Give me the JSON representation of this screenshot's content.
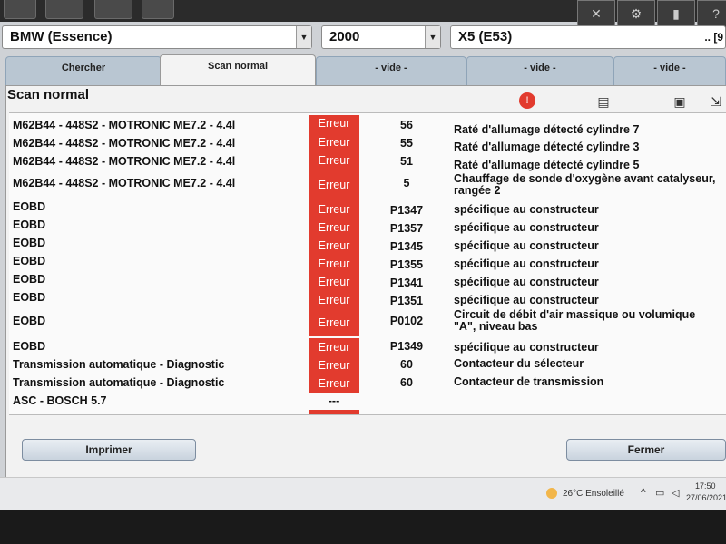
{
  "header": {
    "make": "BMW (Essence)",
    "year": "2000",
    "model": "X5 (E53)",
    "model_extra": ".. [9"
  },
  "toolbar_right": {
    "icons": [
      "tools-icon",
      "settings-icon",
      "book-icon",
      "help-icon"
    ],
    "help_label": "?"
  },
  "tabs": [
    {
      "label": "Chercher",
      "active": false
    },
    {
      "label": "Scan normal",
      "active": true
    },
    {
      "label": "- vide -",
      "active": false
    },
    {
      "label": "- vide -",
      "active": false
    },
    {
      "label": "- vide -",
      "active": false
    }
  ],
  "panel": {
    "title": "Scan normal",
    "stop_label": "!"
  },
  "rows": [
    {
      "system": "M62B44 - 448S2 - MOTRONIC ME7.2 - 4.4l",
      "status": "Erreur",
      "code": "56",
      "desc": "Raté d'allumage détecté cylindre 7"
    },
    {
      "system": "M62B44 - 448S2 - MOTRONIC ME7.2 - 4.4l",
      "status": "Erreur",
      "code": "55",
      "desc": "Raté d'allumage détecté cylindre 3"
    },
    {
      "system": "M62B44 - 448S2 - MOTRONIC ME7.2 - 4.4l",
      "status": "Erreur",
      "code": "51",
      "desc": "Raté d'allumage détecté cylindre 5"
    },
    {
      "system": "M62B44 - 448S2 - MOTRONIC ME7.2 - 4.4l",
      "status": "Erreur",
      "code": "5",
      "desc": "Chauffage de sonde d'oxygène avant catalyseur, rangée 2"
    },
    {
      "system": "EOBD",
      "status": "Erreur",
      "code": "P1347",
      "desc": "spécifique au constructeur"
    },
    {
      "system": "EOBD",
      "status": "Erreur",
      "code": "P1357",
      "desc": "spécifique au constructeur"
    },
    {
      "system": "EOBD",
      "status": "Erreur",
      "code": "P1345",
      "desc": "spécifique au constructeur"
    },
    {
      "system": "EOBD",
      "status": "Erreur",
      "code": "P1355",
      "desc": "spécifique au constructeur"
    },
    {
      "system": "EOBD",
      "status": "Erreur",
      "code": "P1341",
      "desc": "spécifique au constructeur"
    },
    {
      "system": "EOBD",
      "status": "Erreur",
      "code": "P1351",
      "desc": "spécifique au constructeur"
    },
    {
      "system": "EOBD",
      "status": "Erreur",
      "code": "P0102",
      "desc": "Circuit de débit d'air massique ou volumique \"A\", niveau bas"
    },
    {
      "system": "EOBD",
      "status": "Erreur",
      "code": "P1349",
      "desc": "spécifique au constructeur"
    },
    {
      "system": "Transmission automatique - Diagnostic",
      "status": "Erreur",
      "code": "60",
      "desc": "Contacteur du sélecteur"
    },
    {
      "system": "Transmission automatique - Diagnostic",
      "status": "Erreur",
      "code": "60",
      "desc": "Contacteur de transmission"
    },
    {
      "system": "ASC - BOSCH 5.7",
      "status": "---",
      "code": "",
      "desc": ""
    }
  ],
  "buttons": {
    "print": "Imprimer",
    "close": "Fermer"
  },
  "taskbar": {
    "weather": "26°C  Ensoleillé",
    "time": "17:50",
    "date": "27/06/2021"
  },
  "colors": {
    "error": "#e23b2e",
    "tab_inactive": "#b9c6d2"
  }
}
